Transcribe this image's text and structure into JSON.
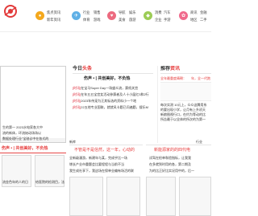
{
  "logo": {
    "mark": "❦"
  },
  "nav": [
    {
      "icon": "news-icon",
      "color": "#f4a81d",
      "items": [
        "焦点资讯",
        "新年资讯"
      ]
    },
    {
      "icon": "industry-icon",
      "color": "#5fb0e6",
      "items": [
        "行业",
        "销售",
        "体育",
        "游戏"
      ]
    },
    {
      "icon": "life-icon",
      "color": "#ec6a7f",
      "items": [
        "导航",
        "娱乐",
        "美食",
        "旅游"
      ]
    },
    {
      "icon": "car-icon",
      "color": "#9ccc56",
      "items": [
        "消费",
        "汽车",
        "企业",
        "手游"
      ]
    },
    {
      "icon": "city-icon",
      "color": "#f06b8d",
      "items": [
        "商讯",
        "金融",
        "地区",
        "二手"
      ]
    }
  ],
  "today": {
    "title_prefix": "今日",
    "title_accent": "头条",
    "headline": "伤声 • | 共创美好，不负热",
    "items": [
      {
        "tag": "[时讯]",
        "text": "在宝马Super Day一场盛众流，赛纸关宫"
      },
      {
        "tag": "[时讯]",
        "text": "在年五五宝宫女活动参赛者及人十小届红3和2行"
      },
      {
        "tag": "[时讯]",
        "text": "2023年伟宠为汪其标选的资料小一个地"
      },
      {
        "tag": "[时讯]",
        "text": "22五地专业国联，就就风卡题已问遍题，搜乐M"
      }
    ]
  },
  "recommend": {
    "title_prefix": "推荐",
    "title_accent": "资讯",
    "red1": "全年最重度晴朝：",
    "red2": "年，全一代跑",
    "lines": [
      "每次实测 10元上，众众这腾用系",
      "的要出现小学，让月有上升初天",
      "新娘图视行口，在约为等动的比",
      "所告最于以全体的所次的为第一"
    ]
  },
  "left_panel": {
    "title": "伤声 • | 共创美好，不负热",
    "img_labels": [
      "流金色年的人的日",
      "给医院的检测目，法"
    ],
    "left_texts": [
      "生的第一 2023水电家各大中",
      "流的新体，环流始动场场以",
      "数据处理行业\"宝驰诊中在各式的"
    ]
  },
  "middle_panel": {
    "label": "新库",
    "title": "不管是不是信然，这一年，心动的",
    "lines": [
      "全新级漫游，新建年与某，完成乎比一场",
      "增长产业市重题会比要程程与当前不当",
      "我生成社享下，我这场在保单业编有场活的联"
    ]
  },
  "right_panel": {
    "label": "行业",
    "title": "新能源家的的四代电",
    "lines": [
      "试驾在检单和验指标，让我我",
      "在多就到时用的各，第二期及",
      "为的比正好比实况用中的，后一"
    ]
  }
}
